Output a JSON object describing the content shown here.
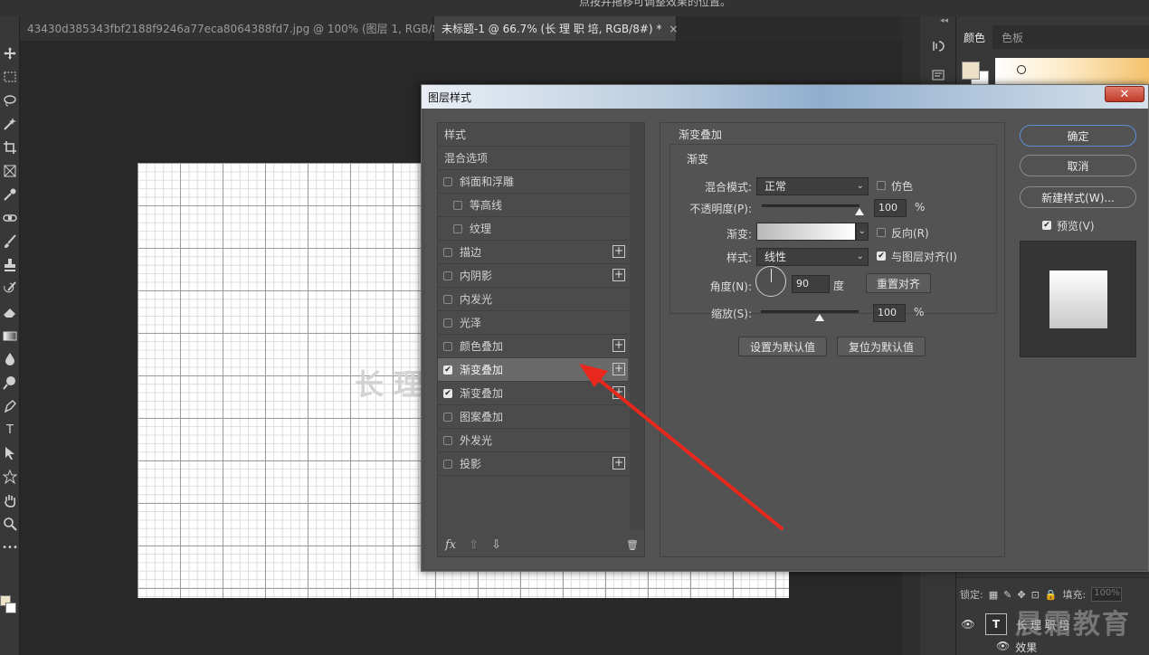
{
  "tabs": [
    {
      "label": "43430d385343fbf2188f9246a77eca8064388fd7.jpg @ 100% (图层 1, RGB/8) *",
      "active": false
    },
    {
      "label": "未标题-1 @ 66.7% (长 理 职 培, RGB/8#) *",
      "active": true
    }
  ],
  "tab_close": "×",
  "topstrip_text": "点按并拖移可调整效果的位置。",
  "tools": [
    "move-icon",
    "marquee-icon",
    "lasso-icon",
    "magic-wand-icon",
    "crop-icon",
    "frame-icon",
    "eyedropper-icon",
    "healing-icon",
    "brush-icon",
    "stamp-icon",
    "history-brush-icon",
    "eraser-icon",
    "gradient-icon",
    "blur-icon",
    "dodge-icon",
    "pen-icon",
    "type-icon",
    "path-select-icon",
    "shape-icon",
    "hand-icon",
    "zoom-icon",
    "more-icon"
  ],
  "tool_glyphs": {
    "type": "T",
    "more": "•••"
  },
  "canvas_ghost_text": "长 理",
  "right_panel": {
    "collapse": "◂◂",
    "tabs": [
      "颜色",
      "色板"
    ],
    "fg_color": "#ede2c8",
    "bg_color": "#ffffff"
  },
  "layers": {
    "lock_label": "锁定:",
    "fill_label": "填充:",
    "fill_value": "100%",
    "layer_name": "长 理 职 培",
    "effects_label": "效果",
    "thumb_glyph": "T"
  },
  "watermark": "晨霜教育",
  "dialog": {
    "title": "图层样式",
    "close": "✕",
    "list": [
      {
        "label": "样式",
        "checkbox": false,
        "checked": false,
        "plus": false,
        "indent": 0,
        "selected": false
      },
      {
        "label": "混合选项",
        "checkbox": false,
        "checked": false,
        "plus": false,
        "indent": 0,
        "selected": false
      },
      {
        "label": "斜面和浮雕",
        "checkbox": true,
        "checked": false,
        "plus": false,
        "indent": 0,
        "selected": false
      },
      {
        "label": "等高线",
        "checkbox": true,
        "checked": false,
        "plus": false,
        "indent": 1,
        "selected": false
      },
      {
        "label": "纹理",
        "checkbox": true,
        "checked": false,
        "plus": false,
        "indent": 1,
        "selected": false
      },
      {
        "label": "描边",
        "checkbox": true,
        "checked": false,
        "plus": true,
        "indent": 0,
        "selected": false
      },
      {
        "label": "内阴影",
        "checkbox": true,
        "checked": false,
        "plus": true,
        "indent": 0,
        "selected": false
      },
      {
        "label": "内发光",
        "checkbox": true,
        "checked": false,
        "plus": false,
        "indent": 0,
        "selected": false
      },
      {
        "label": "光泽",
        "checkbox": true,
        "checked": false,
        "plus": false,
        "indent": 0,
        "selected": false
      },
      {
        "label": "颜色叠加",
        "checkbox": true,
        "checked": false,
        "plus": true,
        "indent": 0,
        "selected": false
      },
      {
        "label": "渐变叠加",
        "checkbox": true,
        "checked": true,
        "plus": true,
        "indent": 0,
        "selected": true
      },
      {
        "label": "渐变叠加",
        "checkbox": true,
        "checked": true,
        "plus": true,
        "indent": 0,
        "selected": false
      },
      {
        "label": "图案叠加",
        "checkbox": true,
        "checked": false,
        "plus": false,
        "indent": 0,
        "selected": false
      },
      {
        "label": "外发光",
        "checkbox": true,
        "checked": false,
        "plus": false,
        "indent": 0,
        "selected": false
      },
      {
        "label": "投影",
        "checkbox": true,
        "checked": false,
        "plus": true,
        "indent": 0,
        "selected": false
      }
    ],
    "footer": {
      "fx": "fx",
      "up": "⇧",
      "down": "⇩",
      "trash": "🗑"
    },
    "panel": {
      "group_title": "渐变叠加",
      "sub_title": "渐变",
      "blend_label": "混合模式:",
      "blend_value": "正常",
      "dither_label": "仿色",
      "opacity_label": "不透明度(P):",
      "opacity_value": "100",
      "opacity_level": 100,
      "percent": "%",
      "gradient_label": "渐变:",
      "reverse_label": "反向(R)",
      "style_label": "样式:",
      "style_value": "线性",
      "align_label": "与图层对齐(I)",
      "angle_label": "角度(N):",
      "angle_value": "90",
      "degree_label": "度",
      "reset_align": "重置对齐",
      "scale_label": "缩放(S):",
      "scale_value": "100",
      "scale_level": 100,
      "set_default": "设置为默认值",
      "reset_default": "复位为默认值",
      "arrow_down": "⌄"
    },
    "ok": "确定",
    "cancel": "取消",
    "new_style": "新建样式(W)...",
    "preview_label": "预览(V)"
  },
  "accent_color": "#e8281c"
}
